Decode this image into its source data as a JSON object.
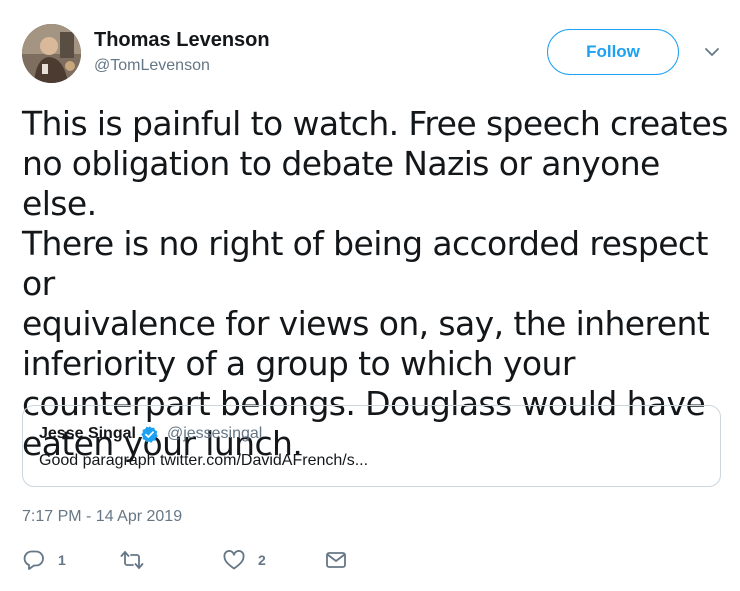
{
  "author": {
    "display_name": "Thomas Levenson",
    "handle": "@TomLevenson"
  },
  "follow_label": "Follow",
  "tweet": {
    "text": "This is painful to watch. Free speech creates\nno obligation to debate Nazis or anyone else.\nThere is no right of being accorded respect or\nequivalence for views on, say, the inherent\ninferiority of a group to which your\ncounterpart belongs. Douglass would have\neaten your lunch."
  },
  "quote": {
    "display_name": "Jesse Singal",
    "handle": "@jessesingal",
    "text": "Good paragraph twitter.com/DavidAFrench/s..."
  },
  "timestamp": "7:17 PM - 14 Apr 2019",
  "actions": {
    "reply_count": "1",
    "retweet_count": "",
    "like_count": "2"
  },
  "colors": {
    "accent": "#1da1f2",
    "secondary_text": "#657786",
    "border": "#ccd6dd"
  },
  "icons": {
    "reply": "reply-icon",
    "retweet": "retweet-icon",
    "like": "heart-icon",
    "dm": "envelope-icon",
    "more": "chevron-down-icon",
    "verified": "verified-badge-icon"
  }
}
